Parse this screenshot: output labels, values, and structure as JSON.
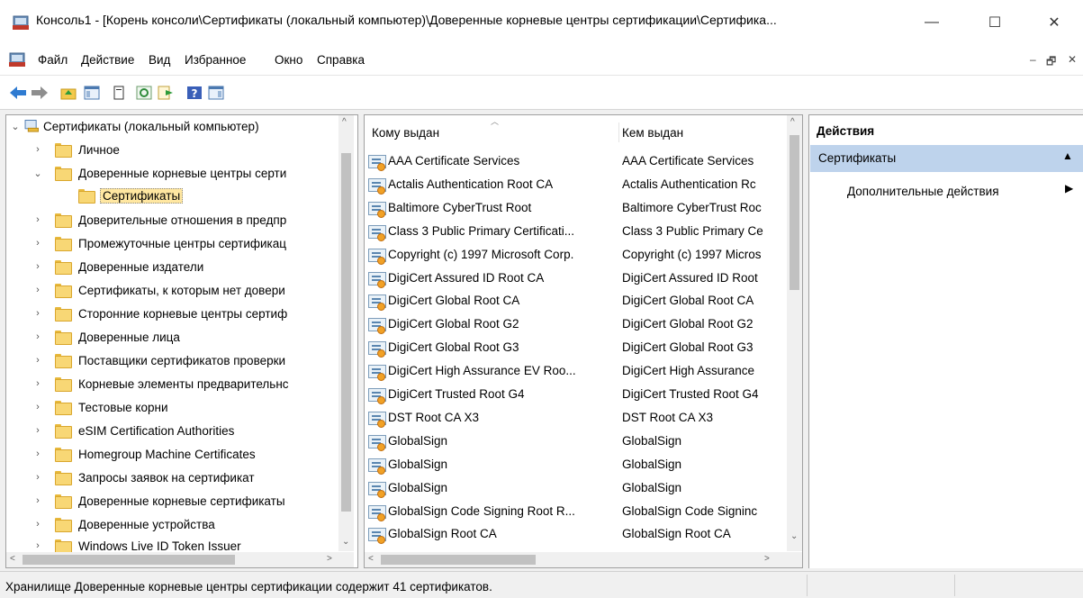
{
  "window": {
    "title": "Консоль1 - [Корень консоли\\Сертификаты (локальный компьютер)\\Доверенные корневые центры сертификации\\Сертифика...",
    "controls": {
      "minimize": "—",
      "maximize": "☐",
      "close": "✕"
    }
  },
  "menu": {
    "items": [
      "Файл",
      "Действие",
      "Вид",
      "Избранное",
      "Окно",
      "Справка"
    ],
    "mdi_minimize": "–",
    "mdi_restore": "🗗",
    "mdi_close": "✕"
  },
  "toolbar": {
    "icons": [
      "back-arrow-icon",
      "forward-arrow-icon",
      "up-folder-icon",
      "show-hide-tree-icon",
      "delete-icon",
      "refresh-icon",
      "export-list-icon",
      "help-icon",
      "show-hide-action-pane-icon"
    ]
  },
  "tree": {
    "root": "Сертификаты (локальный компьютер)",
    "items": [
      {
        "label": "Личное",
        "expanded": false,
        "level": 1
      },
      {
        "label": "Доверенные корневые центры серти",
        "expanded": true,
        "level": 1
      },
      {
        "label": "Сертификаты",
        "selected": true,
        "level": 2
      },
      {
        "label": "Доверительные отношения в предпр",
        "expanded": false,
        "level": 1
      },
      {
        "label": "Промежуточные центры сертификац",
        "expanded": false,
        "level": 1
      },
      {
        "label": "Доверенные издатели",
        "expanded": false,
        "level": 1
      },
      {
        "label": "Сертификаты, к которым нет довери",
        "expanded": false,
        "level": 1
      },
      {
        "label": "Сторонние корневые центры сертиф",
        "expanded": false,
        "level": 1
      },
      {
        "label": "Доверенные лица",
        "expanded": false,
        "level": 1
      },
      {
        "label": "Поставщики сертификатов проверки",
        "expanded": false,
        "level": 1
      },
      {
        "label": "Корневые элементы предварительнс",
        "expanded": false,
        "level": 1
      },
      {
        "label": "Тестовые корни",
        "expanded": false,
        "level": 1
      },
      {
        "label": "eSIM Certification Authorities",
        "expanded": false,
        "level": 1
      },
      {
        "label": "Homegroup Machine Certificates",
        "expanded": false,
        "level": 1
      },
      {
        "label": "Запросы заявок на сертификат",
        "expanded": false,
        "level": 1
      },
      {
        "label": "Доверенные корневые сертификаты",
        "expanded": false,
        "level": 1
      },
      {
        "label": "Доверенные устройства",
        "expanded": false,
        "level": 1
      },
      {
        "label": "Windows Live ID Token Issuer",
        "expanded": false,
        "level": 1
      }
    ]
  },
  "list": {
    "columns": [
      "Кому выдан",
      "Кем выдан"
    ],
    "rows": [
      [
        "AAA Certificate Services",
        "AAA Certificate Services"
      ],
      [
        "Actalis Authentication Root CA",
        "Actalis Authentication Rc"
      ],
      [
        "Baltimore CyberTrust Root",
        "Baltimore CyberTrust Roc"
      ],
      [
        "Class 3 Public Primary Certificati...",
        "Class 3 Public Primary Ce"
      ],
      [
        "Copyright (c) 1997 Microsoft Corp.",
        "Copyright (c) 1997 Micros"
      ],
      [
        "DigiCert Assured ID Root CA",
        "DigiCert Assured ID Root"
      ],
      [
        "DigiCert Global Root CA",
        "DigiCert Global Root CA"
      ],
      [
        "DigiCert Global Root G2",
        "DigiCert Global Root G2"
      ],
      [
        "DigiCert Global Root G3",
        "DigiCert Global Root G3"
      ],
      [
        "DigiCert High Assurance EV Roo...",
        "DigiCert High Assurance"
      ],
      [
        "DigiCert Trusted Root G4",
        "DigiCert Trusted Root G4"
      ],
      [
        "DST Root CA X3",
        "DST Root CA X3"
      ],
      [
        "GlobalSign",
        "GlobalSign"
      ],
      [
        "GlobalSign",
        "GlobalSign"
      ],
      [
        "GlobalSign",
        "GlobalSign"
      ],
      [
        "GlobalSign Code Signing Root R...",
        "GlobalSign Code Signinc"
      ],
      [
        "GlobalSign Root CA",
        "GlobalSign Root CA"
      ]
    ]
  },
  "actions": {
    "title": "Действия",
    "group": "Сертификаты",
    "more": "Дополнительные действия"
  },
  "status": {
    "text": "Хранилище Доверенные корневые центры сертификации содержит 41 сертификатов."
  }
}
